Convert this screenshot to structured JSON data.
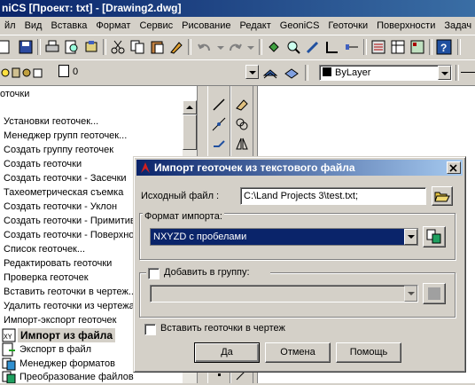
{
  "window": {
    "title": "niCS [Проект: txt] - [Drawing2.dwg]"
  },
  "menu": [
    "йл",
    "Вид",
    "Вставка",
    "Формат",
    "Сервис",
    "Рисование",
    "Редакт",
    "GeoniCS",
    "Геоточки",
    "Поверхности",
    "Задач"
  ],
  "layer_toolbar": {
    "layer_value": "0",
    "color_value": "ByLayer"
  },
  "panel": {
    "header": "оточки",
    "items": [
      "Установки геоточек...",
      "Менеджер групп геоточек...",
      "Создать группу геоточек",
      "Создать геоточки",
      "Создать геоточки - Засечки",
      "Тахеометрическая съемка",
      "Создать геоточки - Уклон",
      "Создать геоточки - Примитив",
      "Создать геоточки - Поверхнос",
      "Список геоточек...",
      "Редактировать геоточки",
      "Проверка геоточек",
      "Вставить геоточки в чертеж...",
      "Удалить геоточки из чертежа",
      "Импорт-экспорт геоточек"
    ],
    "subitems": [
      {
        "label": "Импорт из файла",
        "icon": "import-file-icon",
        "selected": true
      },
      {
        "label": "Экспорт в файл",
        "icon": "export-file-icon",
        "selected": false
      },
      {
        "label": "Менеджер форматов",
        "icon": "format-manager-icon",
        "selected": false
      },
      {
        "label": "Преобразование файлов",
        "icon": "convert-files-icon",
        "selected": false
      }
    ]
  },
  "dialog": {
    "title": "Импорт геоточек из текстового файла",
    "source_label": "Исходный файл :",
    "source_value": "C:\\Land Projects 3\\test.txt;",
    "format_label": "Формат импорта:",
    "format_value": "NXYZD с пробелами",
    "add_group_label": "Добавить в группу:",
    "add_group_checked": false,
    "group_value": "",
    "insert_label": "Вставить геоточки в чертеж",
    "insert_checked": false,
    "ok_label": "Да",
    "cancel_label": "Отмена",
    "help_label": "Помощь",
    "accent": "#0a246a"
  }
}
